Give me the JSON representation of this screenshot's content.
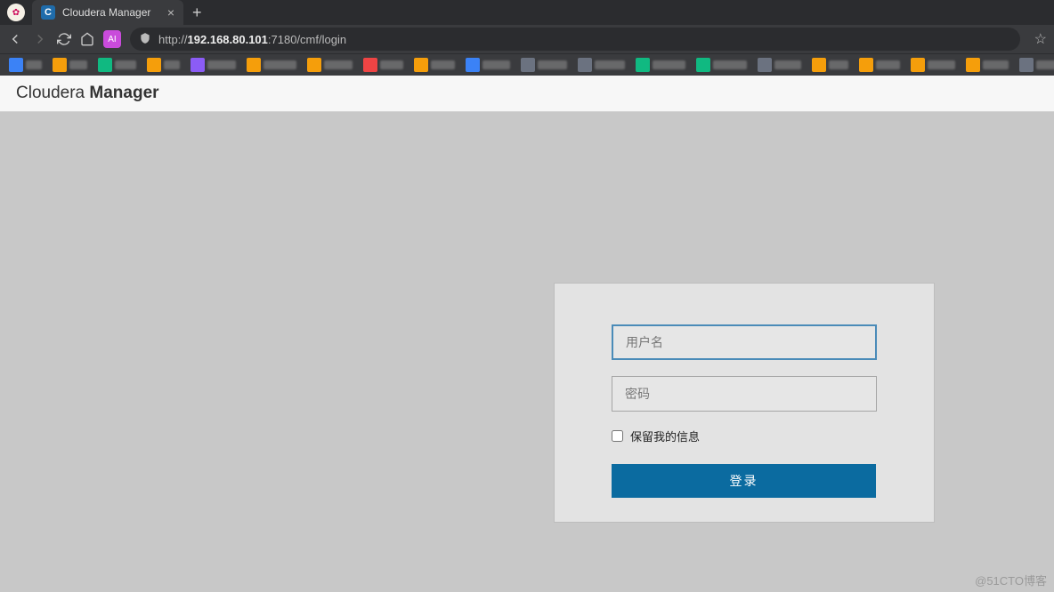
{
  "browser": {
    "tab_title": "Cloudera Manager",
    "tab_favicon_letter": "C",
    "url_prefix": "http://",
    "url_host": "192.168.80.101",
    "url_suffix": ":7180/cmf/login",
    "ext_label": "AI"
  },
  "page": {
    "brand_thin": "Cloudera ",
    "brand_bold": "Manager"
  },
  "login": {
    "username_placeholder": "用户名",
    "password_placeholder": "密码",
    "remember_label": "保留我的信息",
    "submit_label": "登录"
  },
  "watermark": "@51CTO博客",
  "bookmarks_colors": [
    "#3b82f6",
    "#f59e0b",
    "#10b981",
    "#f59e0b",
    "#8b5cf6",
    "#f59e0b",
    "#f59e0b",
    "#ef4444",
    "#f59e0b",
    "#3b82f6",
    "#6b7280",
    "#6b7280",
    "#10b981",
    "#10b981",
    "#6b7280",
    "#f59e0b",
    "#f59e0b",
    "#f59e0b",
    "#f59e0b",
    "#6b7280",
    "#6b7280",
    "#f59e0b",
    "#f59e0b",
    "#f59e0b",
    "#ef4444",
    "#6b7280",
    "#6b7280"
  ]
}
